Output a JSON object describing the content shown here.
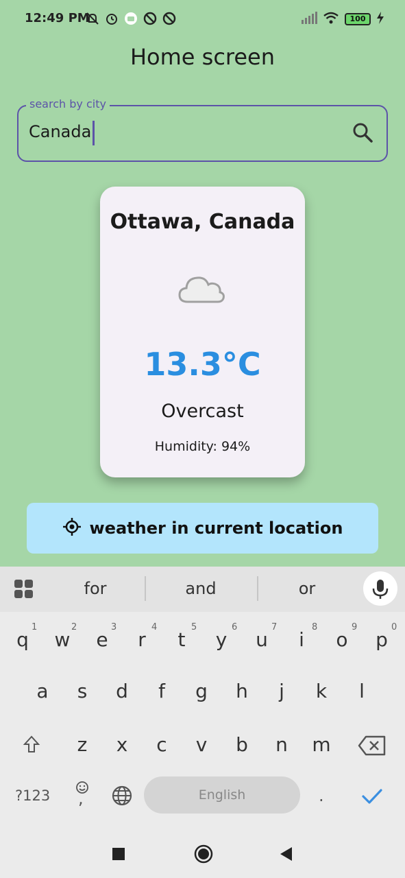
{
  "status_bar": {
    "time": "12:49 PM",
    "battery": "100"
  },
  "app": {
    "title": "Home screen"
  },
  "search": {
    "label": "search by city",
    "value": "Canada"
  },
  "weather_card": {
    "city": "Ottawa, Canada",
    "icon": "cloud-icon",
    "temperature": "13.3°C",
    "condition": "Overcast",
    "humidity": "Humidity: 94%"
  },
  "location_button": {
    "label": "weather in current location",
    "icon": "gps-target-icon"
  },
  "keyboard": {
    "suggestions": [
      "for",
      "and",
      "or"
    ],
    "row1": [
      "q",
      "w",
      "e",
      "r",
      "t",
      "y",
      "u",
      "i",
      "o",
      "p"
    ],
    "row1_hints": [
      "1",
      "2",
      "3",
      "4",
      "5",
      "6",
      "7",
      "8",
      "9",
      "0"
    ],
    "row2": [
      "a",
      "s",
      "d",
      "f",
      "g",
      "h",
      "j",
      "k",
      "l"
    ],
    "row3": [
      "z",
      "x",
      "c",
      "v",
      "b",
      "n",
      "m"
    ],
    "symbols_label": "?123",
    "comma_label": ",",
    "period_label": ".",
    "space_label": "English"
  },
  "colors": {
    "background": "#a5d6a7",
    "accent": "#5c53a8",
    "temperature": "#2a8ee0",
    "button": "#b3e5fc"
  }
}
